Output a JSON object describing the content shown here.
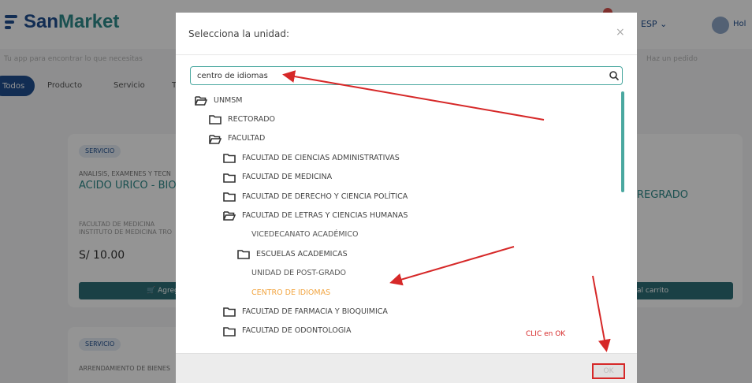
{
  "header": {
    "brand_san": "San",
    "brand_market": "Market",
    "tagline": "Tu app para encontrar lo que necesitas",
    "right_note": "Haz un pedido",
    "lang": "ESP",
    "user_short": "Hol"
  },
  "filters": [
    "Todos",
    "Producto",
    "Servicio",
    "Tr"
  ],
  "cards": [
    {
      "badge": "SERVICIO",
      "category": "ANALISIS, EXAMENES Y TECN",
      "name": "ACIDO URICO - BIOQ",
      "meta1": "FACULTAD DE MEDICINA",
      "meta2": "INSTITUTO DE MEDICINA TRO",
      "price": "S/ 10.00",
      "button": "Agrega",
      "right_name": "REGRADO",
      "right_button": "al carrito"
    },
    {
      "badge": "SERVICIO",
      "category": "ARRENDAMIENTO DE BIENES"
    }
  ],
  "modal": {
    "title": "Selecciona la unidad:",
    "close": "×",
    "search_value": "centro de idiomas",
    "ok_label": "OK",
    "note": "CLIC en OK"
  },
  "tree": [
    {
      "label": "UNMSM",
      "level": 0,
      "type": "folder-open",
      "state": "normal"
    },
    {
      "label": "RECTORADO",
      "level": 1,
      "type": "folder",
      "state": "normal"
    },
    {
      "label": "FACULTAD",
      "level": 1,
      "type": "folder-open",
      "state": "normal"
    },
    {
      "label": "FACULTAD DE CIENCIAS ADMINISTRATIVAS",
      "level": 2,
      "type": "folder",
      "state": "normal"
    },
    {
      "label": "FACULTAD DE MEDICINA",
      "level": 2,
      "type": "folder",
      "state": "normal"
    },
    {
      "label": "FACULTAD DE DERECHO Y CIENCIA POLÍTICA",
      "level": 2,
      "type": "folder",
      "state": "normal"
    },
    {
      "label": "FACULTAD DE LETRAS Y CIENCIAS HUMANAS",
      "level": 2,
      "type": "folder-open",
      "state": "normal"
    },
    {
      "label": "VICEDECANATO ACADÉMICO",
      "level": 3,
      "type": "leaf",
      "state": "normal"
    },
    {
      "label": "ESCUELAS ACADEMICAS",
      "level": 3,
      "type": "folder",
      "state": "normal"
    },
    {
      "label": "UNIDAD DE POST-GRADO",
      "level": 3,
      "type": "leaf",
      "state": "normal"
    },
    {
      "label": "CENTRO DE IDIOMAS",
      "level": 3,
      "type": "leaf",
      "state": "selected"
    },
    {
      "label": "FACULTAD DE FARMACIA Y BIOQUIMICA",
      "level": 2,
      "type": "folder",
      "state": "normal"
    },
    {
      "label": "FACULTAD DE ODONTOLOGIA",
      "level": 2,
      "type": "folder",
      "state": "normal"
    }
  ],
  "colors": {
    "brand_blue": "#1f4f8f",
    "teal": "#4aa8a0",
    "selected": "#f2a541",
    "annotation_red": "#d62828"
  }
}
